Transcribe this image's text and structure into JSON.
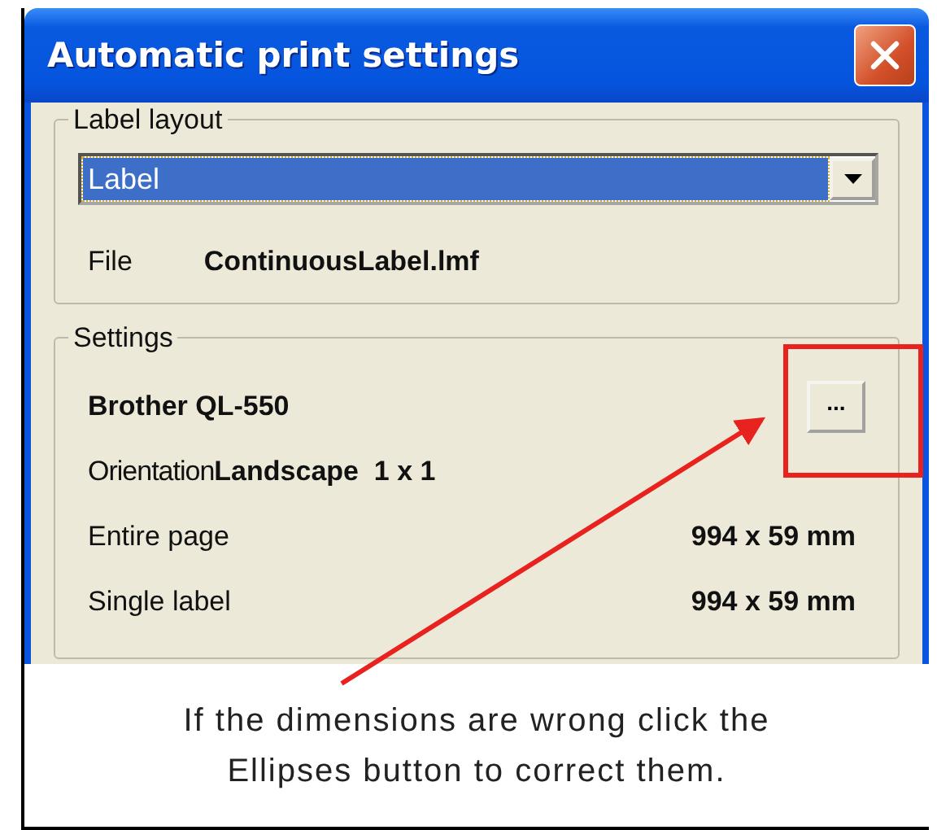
{
  "window": {
    "title": "Automatic print settings"
  },
  "label_layout": {
    "title": "Label layout",
    "dropdown": {
      "value": "Label"
    },
    "file": {
      "label": "File",
      "value": "ContinuousLabel.lmf"
    }
  },
  "settings": {
    "title": "Settings",
    "printer": "Brother QL-550",
    "ellipsis_button": "...",
    "orientation": {
      "label": "Orientation",
      "value": "Landscape  1 x 1"
    },
    "rows": [
      {
        "label": "Entire page",
        "value": "994 x 59 mm"
      },
      {
        "label": "Single label",
        "value": "994 x 59 mm"
      }
    ]
  },
  "annotation": {
    "text": "If the dimensions are wrong click the Ellipses button to correct them."
  }
}
